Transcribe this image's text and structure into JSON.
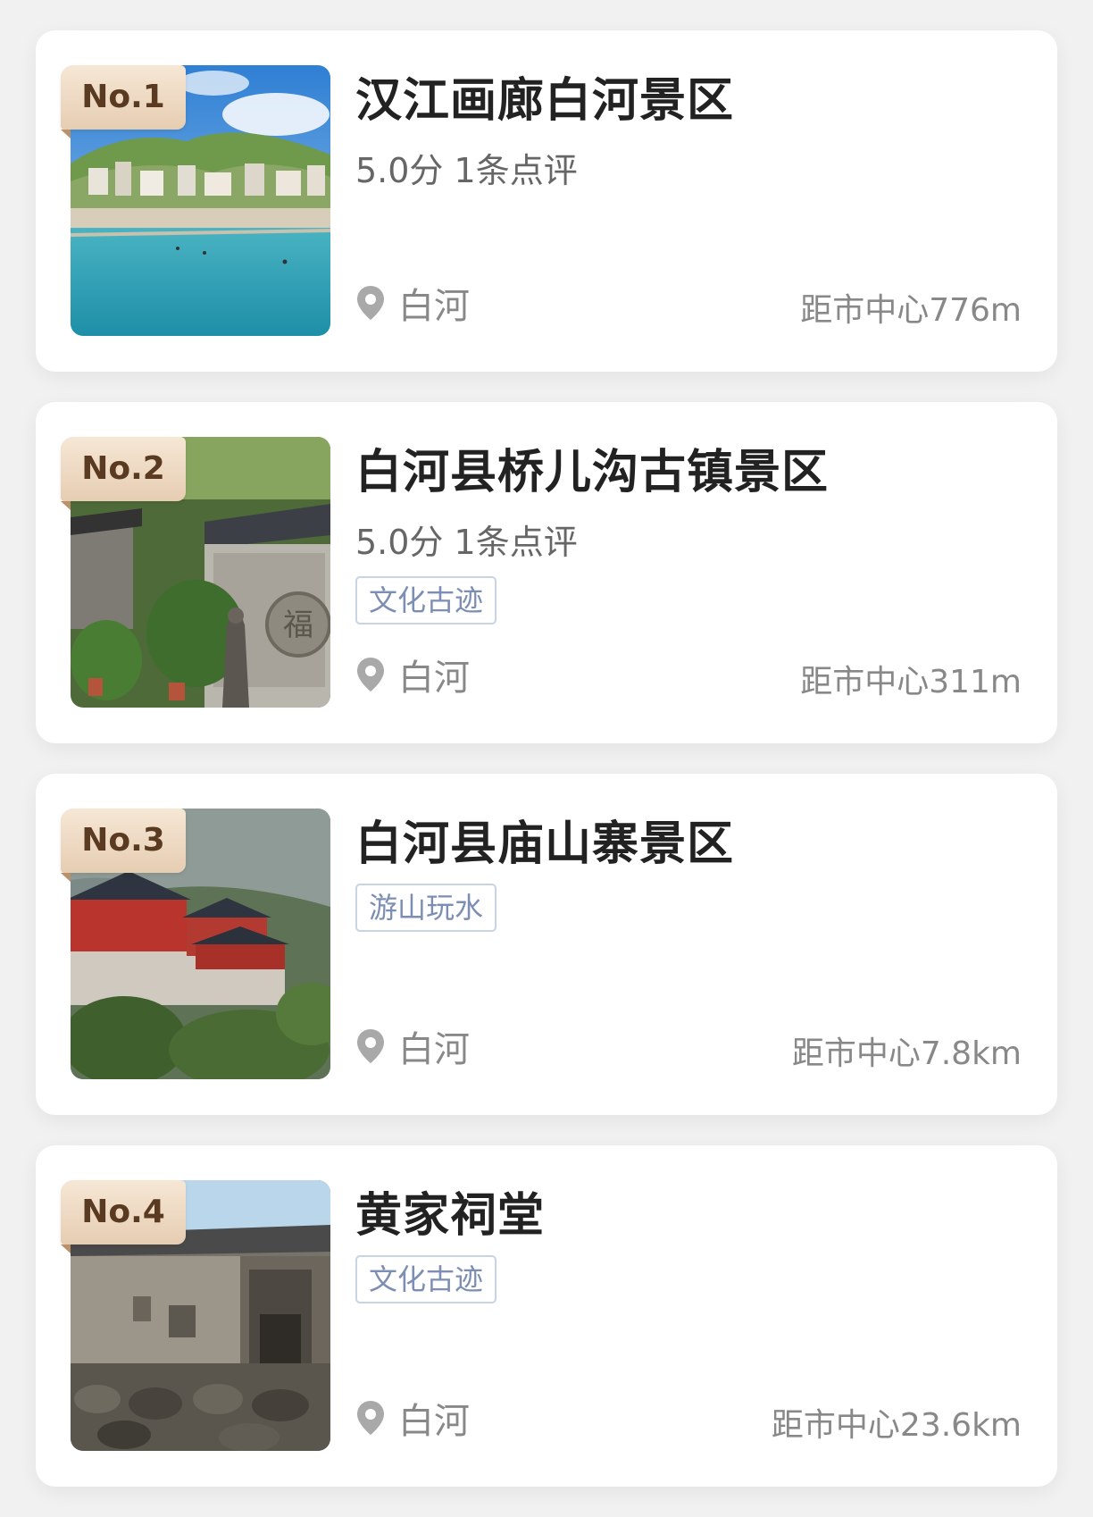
{
  "items": [
    {
      "rank": "No.1",
      "title": "汉江画廊白河景区",
      "rating": "5.0分 1条点评",
      "tag": "",
      "location": "白河",
      "distance": "距市中心776m",
      "image": "river-town-photo"
    },
    {
      "rank": "No.2",
      "title": "白河县桥儿沟古镇景区",
      "rating": "5.0分 1条点评",
      "tag": "文化古迹",
      "location": "白河",
      "distance": "距市中心311m",
      "image": "ancient-town-statue-photo"
    },
    {
      "rank": "No.3",
      "title": "白河县庙山寨景区",
      "rating": "",
      "tag": "游山玩水",
      "location": "白河",
      "distance": "距市中心7.8km",
      "image": "mountain-temple-photo"
    },
    {
      "rank": "No.4",
      "title": "黄家祠堂",
      "rating": "",
      "tag": "文化古迹",
      "location": "白河",
      "distance": "距市中心23.6km",
      "image": "ancestral-hall-photo"
    }
  ],
  "colors": {
    "background": "#f1f1f1",
    "rank_badge": "#ecd8c1",
    "tag_border": "#c9d3e4",
    "tag_text": "#7c8eb3"
  },
  "icons": {
    "location": "location-pin-icon"
  }
}
